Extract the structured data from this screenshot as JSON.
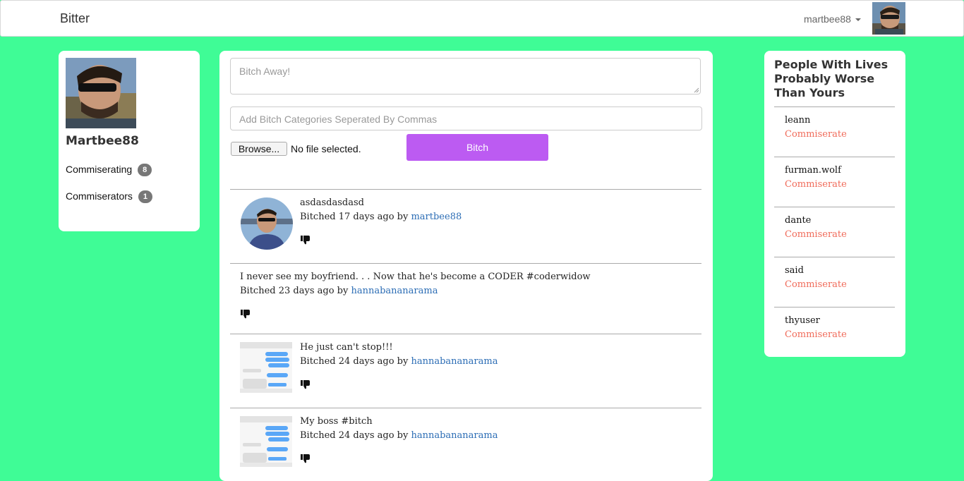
{
  "navbar": {
    "brand": "Bitter",
    "username": "martbee88"
  },
  "profile": {
    "name": "Martbee88",
    "stats": [
      {
        "label": "Commiserating",
        "count": "8"
      },
      {
        "label": "Commiserators",
        "count": "1"
      }
    ]
  },
  "composer": {
    "text_placeholder": "Bitch Away!",
    "categories_placeholder": "Add Bitch Categories Seperated By Commas",
    "browse_label": "Browse...",
    "file_status": "No file selected.",
    "submit_label": "Bitch"
  },
  "feed": [
    {
      "text": "asdasdasdasd",
      "meta_prefix": "Bitched 17 days ago by",
      "author": "martbee88",
      "media": "avatar"
    },
    {
      "text": "I never see my boyfriend. . . Now that he's become a CODER #coderwidow",
      "meta_prefix": "Bitched 23 days ago by",
      "author": "hannabananarama",
      "media": "none"
    },
    {
      "text": "He just can't stop!!!",
      "meta_prefix": "Bitched 24 days ago by",
      "author": "hannabananarama",
      "media": "screenshot"
    },
    {
      "text": "My boss #bitch",
      "meta_prefix": "Bitched 24 days ago by",
      "author": "hannabananarama",
      "media": "screenshot"
    }
  ],
  "sidebar": {
    "title": "People With Lives Probably Worse Than Yours",
    "people": [
      {
        "name": "leann",
        "action": "Commiserate"
      },
      {
        "name": "furman.wolf",
        "action": "Commiserate"
      },
      {
        "name": "dante",
        "action": "Commiserate"
      },
      {
        "name": "said",
        "action": "Commiserate"
      },
      {
        "name": "thyuser",
        "action": "Commiserate"
      }
    ]
  },
  "colors": {
    "background": "#3ffc96",
    "button": "#bc5bf2",
    "link": "#2c6db5",
    "action_link": "#f06b5a"
  }
}
